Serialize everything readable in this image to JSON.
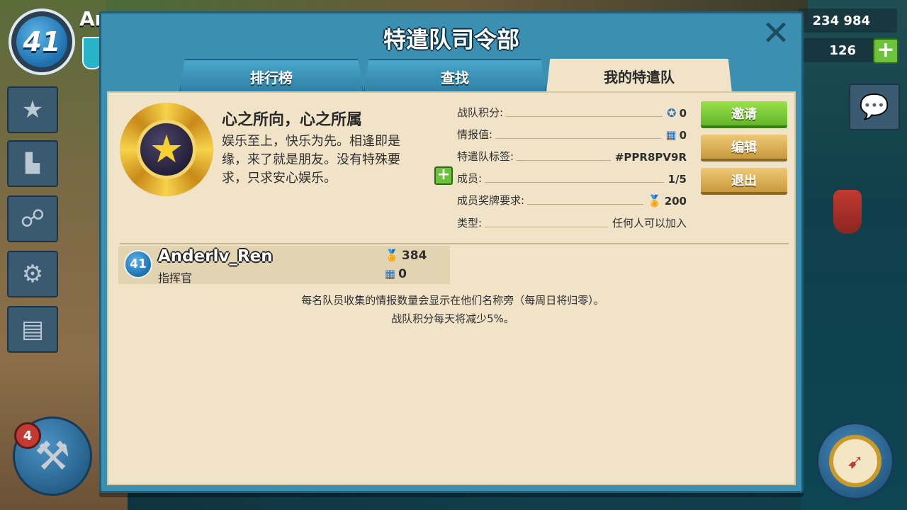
{
  "hud": {
    "player_level": "41",
    "player_name_partial": "An",
    "gold": "234 984",
    "diamonds": "126",
    "plus_label": "+",
    "builder_count": "4"
  },
  "dialog": {
    "title": "特遣队司令部",
    "close_label": "✕",
    "tabs": [
      {
        "label": "排行榜",
        "active": false
      },
      {
        "label": "查找",
        "active": false
      },
      {
        "label": "我的特遣队",
        "active": true
      }
    ]
  },
  "team": {
    "name": "心之所向，心之所属",
    "description": "娱乐至上，快乐为先。相逢即是缘，来了就是朋友。没有特殊要求，只求安心娱乐。",
    "emblem_icon": "star-emblem-icon",
    "stats": {
      "points_label": "战队积分:",
      "points_value": "0",
      "intel_label": "情报值:",
      "intel_value": "0",
      "tag_label": "特遣队标签:",
      "tag_value": "#PPR8PV9R",
      "members_label": "成员:",
      "members_value": "1/5",
      "medal_req_label": "成员奖牌要求:",
      "medal_req_value": "200",
      "type_label": "类型:",
      "type_value": "任何人可以加入"
    }
  },
  "actions": {
    "invite": "邀请",
    "edit": "编辑",
    "leave": "退出"
  },
  "members": [
    {
      "level": "41",
      "name": "Anderlv_Ren",
      "role": "指挥官",
      "medals": "384",
      "intel": "0"
    }
  ],
  "notes": {
    "line1": "每名队员收集的情报数量会显示在他们名称旁（每周日将归零）。",
    "line2": "战队积分每天将减少5%。"
  },
  "colors": {
    "dialog_frame": "#3b8fb0",
    "panel_bg": "#f0e3c7",
    "invite_green": "#7ccb3a",
    "gold_button": "#dcb25a"
  }
}
